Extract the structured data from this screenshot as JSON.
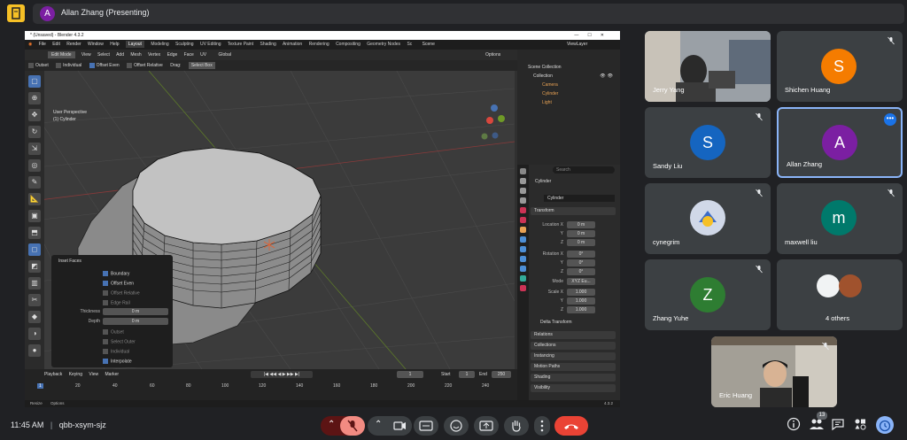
{
  "presenter": {
    "initial": "A",
    "label": "Allan Zhang (Presenting)"
  },
  "blender": {
    "title": "* (Unsaved) - Blender 4.3.2",
    "menu": [
      "File",
      "Edit",
      "Render",
      "Window",
      "Help"
    ],
    "workspaces": [
      "Layout",
      "Modeling",
      "Sculpting",
      "UV Editing",
      "Texture Paint",
      "Shading",
      "Animation",
      "Rendering",
      "Compositing",
      "Geometry Nodes",
      "Sc"
    ],
    "scene": "Scene",
    "view_layer": "ViewLayer",
    "header": {
      "mode": "Edit Mode",
      "items": [
        "View",
        "Select",
        "Add",
        "Mesh",
        "Vertex",
        "Edge",
        "Face",
        "UV"
      ],
      "orientation": "Global",
      "options": "Options"
    },
    "tool_header": {
      "outset": "Outset",
      "individual": "Individual",
      "offset_even": "Offset Even",
      "offset_relative": "Offset Relative",
      "drag": "Drag:",
      "drag_value": "Select Box"
    },
    "viewport": {
      "perspective": "User Perspective",
      "object": "(1) Cylinder"
    },
    "redo_panel": {
      "title": "Inset Faces",
      "boundary": "Boundary",
      "offset_even": "Offset Even",
      "offset_relative": "Offset Relative",
      "edge_rail": "Edge Rail",
      "thickness_label": "Thickness",
      "thickness_value": "0 m",
      "depth_label": "Depth",
      "depth_value": "0 m",
      "outset": "Outset",
      "select_outer": "Select Outer",
      "individual": "Individual",
      "interpolate": "Interpolate"
    },
    "outliner": {
      "title": "Scene Collection",
      "collection": "Collection",
      "items": [
        "Camera",
        "Cylinder",
        "Light"
      ]
    },
    "properties": {
      "search": "Search",
      "object": "Cylinder",
      "object_field": "Cylinder",
      "transform": "Transform",
      "location_x_label": "Location X",
      "rotation_x_label": "Rotation X",
      "scale_x_label": "Scale X",
      "y": "Y",
      "z": "Z",
      "mode_label": "Mode",
      "location": [
        "0 m",
        "0 m",
        "0 m"
      ],
      "rotation": [
        "0°",
        "0°",
        "0°"
      ],
      "mode": "XYZ Eu...",
      "scale": [
        "1.000",
        "1.000",
        "1.000"
      ],
      "sections": [
        "Delta Transform",
        "Relations",
        "Collections",
        "Instancing",
        "Motion Paths",
        "Shading",
        "Visibility"
      ]
    },
    "timeline": {
      "menu": [
        "Playback",
        "Keying",
        "View",
        "Marker"
      ],
      "current_frame": "1",
      "start_label": "Start",
      "start": "1",
      "end_label": "End",
      "end": "250",
      "ticks": [
        "1",
        "20",
        "40",
        "60",
        "80",
        "100",
        "120",
        "140",
        "160",
        "180",
        "200",
        "220",
        "240"
      ]
    },
    "status": {
      "left": "Resize",
      "options": "Options",
      "version": "4.3.2"
    }
  },
  "participants": [
    {
      "name": "Jerry Yang",
      "type": "video"
    },
    {
      "name": "Shichen Huang",
      "initial": "S",
      "color": "#f57c00"
    },
    {
      "name": "Sandy Liu",
      "initial": "S",
      "color": "#1565c0"
    },
    {
      "name": "Allan Zhang",
      "initial": "A",
      "color": "#7b1fa2"
    },
    {
      "name": "cynegrim",
      "type": "image"
    },
    {
      "name": "maxwell liu",
      "initial": "m",
      "color": "#00796b"
    },
    {
      "name": "Zhang Yuhe",
      "initial": "Z",
      "color": "#2e7d32"
    },
    {
      "name": "4 others",
      "type": "group"
    }
  ],
  "self_view": {
    "name": "Eric Huang"
  },
  "bottom": {
    "time": "11:45 AM",
    "separator": "|",
    "code": "qbb-xsym-sjz",
    "participant_count": "13"
  },
  "colors": {
    "background": "#202124",
    "tile": "#3c4043",
    "highlight_border": "#8ab4f8",
    "end_call": "#ea4335"
  }
}
